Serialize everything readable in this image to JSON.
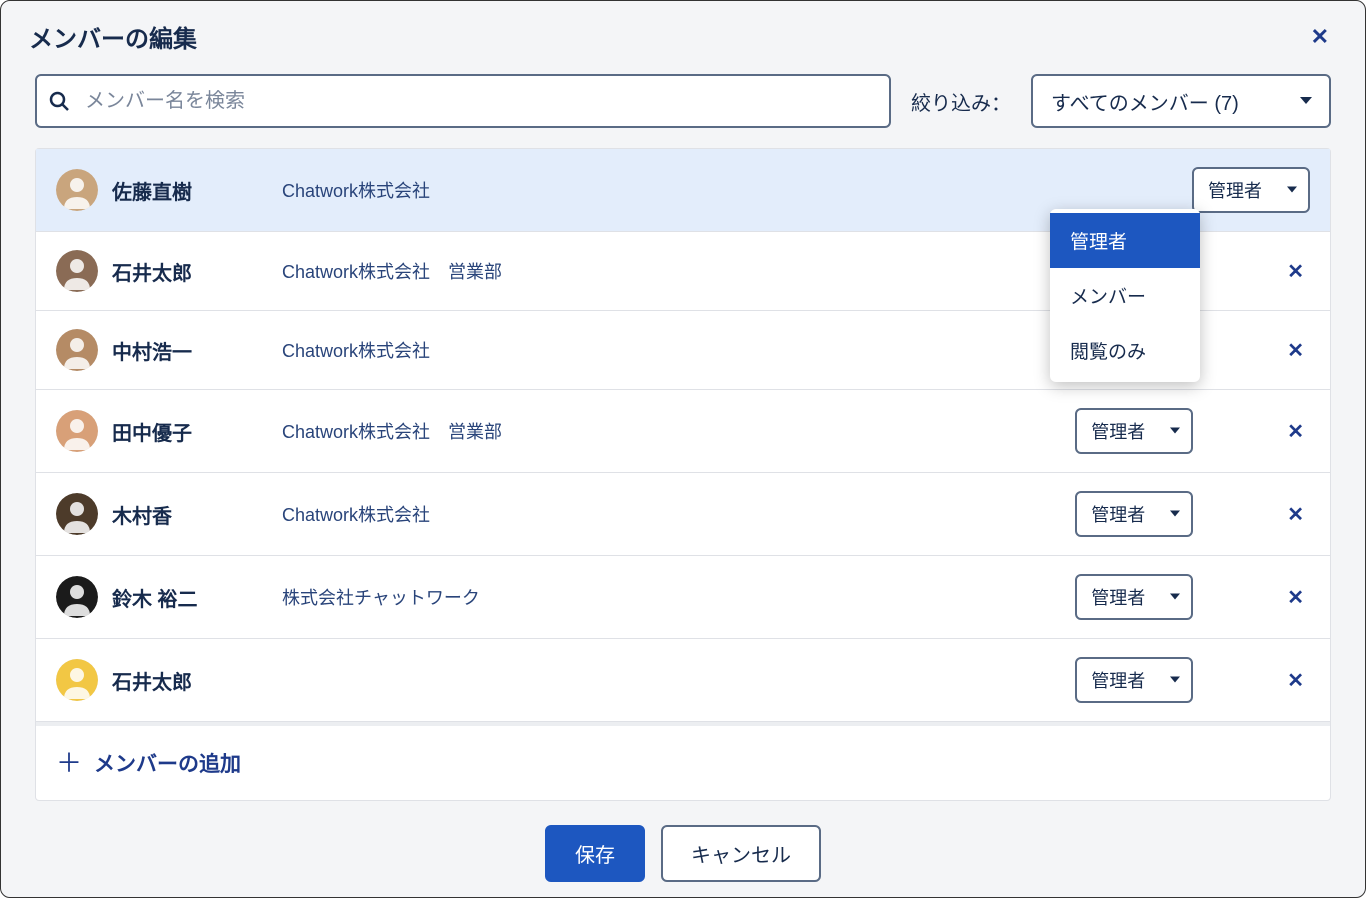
{
  "header": {
    "title": "メンバーの編集"
  },
  "search": {
    "placeholder": "メンバー名を検索"
  },
  "filter": {
    "label": "絞り込み：",
    "selected": "すべてのメンバー (7)"
  },
  "role_options": [
    "管理者",
    "メンバー",
    "閲覧のみ"
  ],
  "members": [
    {
      "name": "佐藤直樹",
      "org": "Chatwork株式会社",
      "dept": "",
      "role": "管理者",
      "removable": false,
      "highlight": true,
      "dropdown_open": true,
      "avatar_color": "#c9a57d"
    },
    {
      "name": "石井太郎",
      "org": "Chatwork株式会社",
      "dept": "営業部",
      "role": "",
      "removable": true,
      "highlight": false,
      "dropdown_open": false,
      "avatar_color": "#8a6b55"
    },
    {
      "name": "中村浩一",
      "org": "Chatwork株式会社",
      "dept": "",
      "role": "",
      "removable": true,
      "highlight": false,
      "dropdown_open": false,
      "avatar_color": "#b58b65"
    },
    {
      "name": "田中優子",
      "org": "Chatwork株式会社",
      "dept": "営業部",
      "role": "管理者",
      "removable": true,
      "highlight": false,
      "dropdown_open": false,
      "avatar_color": "#d8a078"
    },
    {
      "name": "木村香",
      "org": "Chatwork株式会社",
      "dept": "",
      "role": "管理者",
      "removable": true,
      "highlight": false,
      "dropdown_open": false,
      "avatar_color": "#4d3b2a"
    },
    {
      "name": "鈴木 裕二",
      "org": "株式会社チャットワーク",
      "dept": "",
      "role": "管理者",
      "removable": true,
      "highlight": false,
      "dropdown_open": false,
      "avatar_color": "#1b1b1b"
    },
    {
      "name": "石井太郎",
      "org": "",
      "dept": "",
      "role": "管理者",
      "removable": true,
      "highlight": false,
      "dropdown_open": false,
      "avatar_color": "#f2c744"
    }
  ],
  "add_member_label": "メンバーの追加",
  "footer": {
    "save": "保存",
    "cancel": "キャンセル"
  }
}
